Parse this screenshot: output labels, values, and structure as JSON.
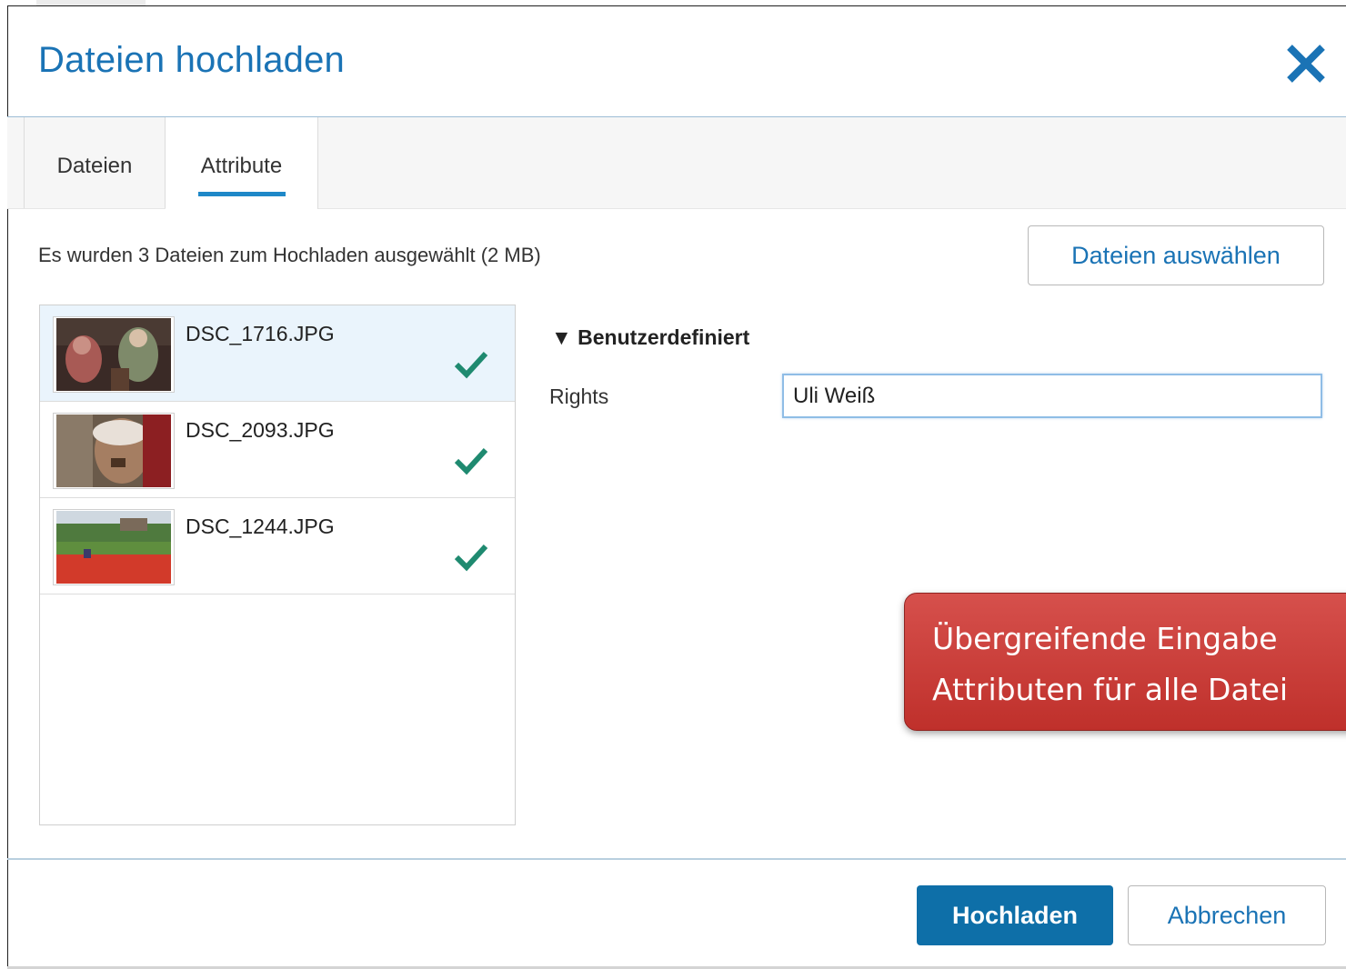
{
  "dialog": {
    "title": "Dateien hochladen",
    "close_icon": "close-icon"
  },
  "tabs": [
    {
      "label": "Dateien",
      "active": false
    },
    {
      "label": "Attribute",
      "active": true
    }
  ],
  "summary_text": "Es wurden 3 Dateien zum Hochladen ausgewählt (2 MB)",
  "select_files_label": "Dateien auswählen",
  "files": [
    {
      "name": "DSC_1716.JPG",
      "status_icon": "check-icon",
      "selected": true
    },
    {
      "name": "DSC_2093.JPG",
      "status_icon": "check-icon",
      "selected": false
    },
    {
      "name": "DSC_1244.JPG",
      "status_icon": "check-icon",
      "selected": false
    }
  ],
  "attributes": {
    "section_title": "▼ Benutzerdefiniert",
    "fields": [
      {
        "label": "Rights",
        "value": "Uli Weiß"
      }
    ]
  },
  "callout_text": "Übergreifende Eingabe\nAttributen für alle Datei",
  "footer": {
    "upload_label": "Hochladen",
    "cancel_label": "Abbrechen"
  },
  "colors": {
    "accent": "#1a73b5",
    "primary_button": "#0e6fa8",
    "check": "#1f8a70",
    "callout": "#c9403b"
  }
}
